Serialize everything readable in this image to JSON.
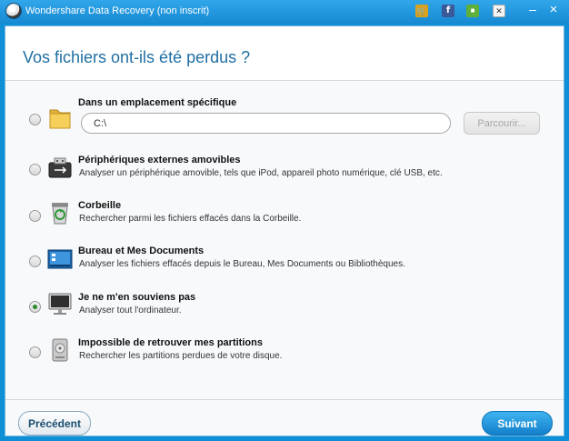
{
  "window": {
    "title": "Wondershare Data Recovery (non inscrit)",
    "toolbar_icons": [
      "cart-icon",
      "facebook-icon",
      "chat-icon",
      "minimize-to-tray-icon"
    ],
    "minimize_label": "–",
    "close_label": "×"
  },
  "page": {
    "title": "Vos fichiers ont-ils été perdus ?"
  },
  "options": [
    {
      "title": "Dans un emplacement spécifique",
      "description": "",
      "icon": "folder-icon",
      "selected": false,
      "path_value": "C:\\",
      "browse_label": "Parcourir..."
    },
    {
      "title": "Périphériques externes amovibles",
      "description": "Analyser un périphérique amovible, tels que iPod, appareil photo numérique, clé USB, etc.",
      "icon": "usb-drive-icon",
      "selected": false
    },
    {
      "title": "Corbeille",
      "description": "Rechercher parmi les fichiers effacés dans la Corbeille.",
      "icon": "recycle-bin-icon",
      "selected": false
    },
    {
      "title": "Bureau et Mes Documents",
      "description": "Analyser les fichiers effacés depuis le Bureau, Mes Documents ou Bibliothèques.",
      "icon": "desktop-icon",
      "selected": false
    },
    {
      "title": "Je ne m'en souviens pas",
      "description": "Analyser tout l'ordinateur.",
      "icon": "monitor-icon",
      "selected": true
    },
    {
      "title": "Impossible de retrouver mes partitions",
      "description": "Rechercher les partitions perdues de votre disque.",
      "icon": "hard-disk-icon",
      "selected": false
    }
  ],
  "footer": {
    "previous_label": "Précédent",
    "next_label": "Suivant"
  }
}
